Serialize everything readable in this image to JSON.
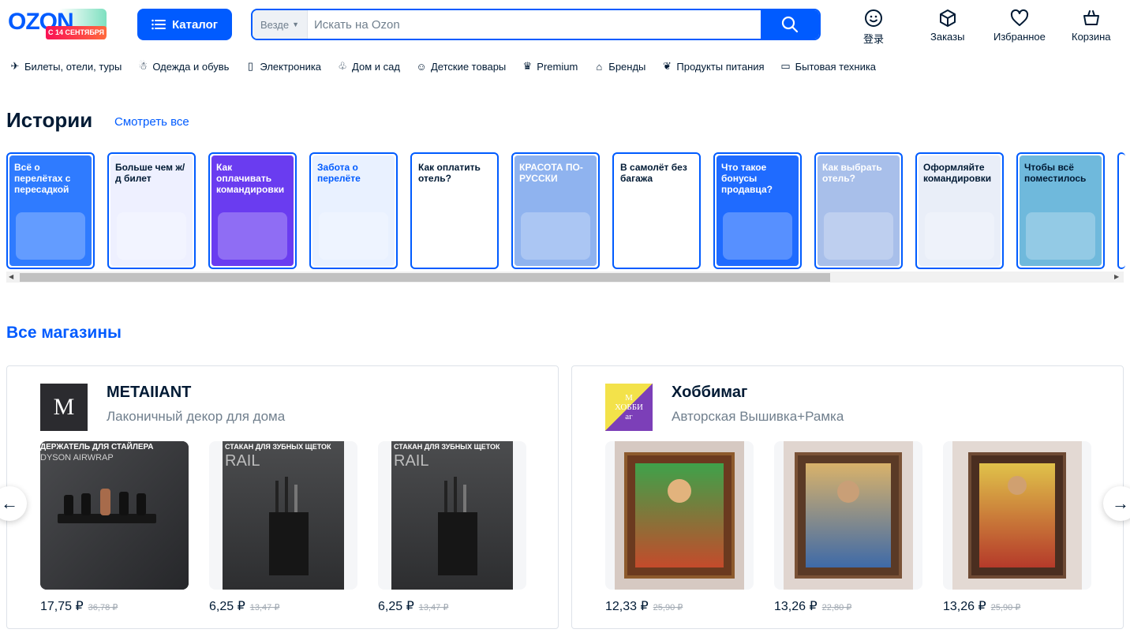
{
  "header": {
    "logo_text": "OZON",
    "logo_badge": "С 14 СЕНТЯБРЯ",
    "catalog_label": "Каталог",
    "search_scope": "Везде",
    "search_placeholder": "Искать на Ozon",
    "login_label": "登录",
    "orders_label": "Заказы",
    "favorites_label": "Избранное",
    "cart_label": "Корзина"
  },
  "nav": [
    {
      "label": "Билеты, отели, туры",
      "icon": "plane-icon"
    },
    {
      "label": "Одежда и обувь",
      "icon": "clothes-icon"
    },
    {
      "label": "Электроника",
      "icon": "phone-icon"
    },
    {
      "label": "Дом и сад",
      "icon": "plant-icon"
    },
    {
      "label": "Детские товары",
      "icon": "baby-icon"
    },
    {
      "label": "Premium",
      "icon": "crown-icon"
    },
    {
      "label": "Бренды",
      "icon": "store-icon"
    },
    {
      "label": "Продукты питания",
      "icon": "food-icon"
    },
    {
      "label": "Бытовая техника",
      "icon": "appliance-icon"
    }
  ],
  "stories": {
    "title": "Истории",
    "see_all": "Смотреть все",
    "items": [
      {
        "text": "Всё о перелётах с пересадкой",
        "bg": "#2f7bff",
        "color": "#ffffff"
      },
      {
        "text": "Больше чем ж/д билет",
        "bg": "#eef0ff",
        "color": "#001a34"
      },
      {
        "text": "Как оплачивать командировки",
        "bg": "#6a3cf0",
        "color": "#ffffff"
      },
      {
        "text": "Забота о перелёте",
        "bg": "#e9f1ff",
        "color": "#005bff"
      },
      {
        "text": "Как оплатить отель?",
        "bg": "#ffffff",
        "color": "#001a34"
      },
      {
        "text": "КРАСОТА ПО-РУССКИ",
        "bg": "#8fb3ef",
        "color": "#ffffff"
      },
      {
        "text": "В самолёт без багажа",
        "bg": "#ffffff",
        "color": "#001a34"
      },
      {
        "text": "Что такое бонусы продавца?",
        "bg": "#1f6bff",
        "color": "#ffffff"
      },
      {
        "text": "Как выбрать отель?",
        "bg": "#a8bfea",
        "color": "#ffffff"
      },
      {
        "text": "Оформляйте командировки",
        "bg": "#e9eef8",
        "color": "#001a34"
      },
      {
        "text": "Чтобы всё поместилось",
        "bg": "#6fb9dc",
        "color": "#001a34"
      }
    ]
  },
  "shops": {
    "title": "Все магазины",
    "cards": [
      {
        "name": "METAIIANT",
        "desc": "Лаконичный декор для дома",
        "logo_letter": "M",
        "products": [
          {
            "caption": "ДЕРЖАТЕЛЬ ДЛЯ СТАЙЛЕРА",
            "sub": "DYSON AIRWRAP",
            "price": "17,75 ₽",
            "old": "36,78 ₽"
          },
          {
            "caption": "СТАКАН ДЛЯ ЗУБНЫХ ЩЕТОК",
            "sub": "RAIL",
            "price": "6,25 ₽",
            "old": "13,47 ₽"
          },
          {
            "caption": "СТАКАН ДЛЯ ЗУБНЫХ ЩЕТОК",
            "sub": "RAIL",
            "price": "6,25 ₽",
            "old": "13,47 ₽"
          }
        ]
      },
      {
        "name": "Хоббимаг",
        "desc": "Авторская Вышивка+Рамка",
        "logo_letter": "М ХОББИ аг",
        "products": [
          {
            "caption": "",
            "sub": "",
            "price": "12,33 ₽",
            "old": "25,90 ₽"
          },
          {
            "caption": "",
            "sub": "",
            "price": "13,26 ₽",
            "old": "22,80 ₽"
          },
          {
            "caption": "",
            "sub": "",
            "price": "13,26 ₽",
            "old": "25,90 ₽"
          }
        ]
      }
    ]
  },
  "colors": {
    "accent": "#005bff",
    "text": "#001a34",
    "muted": "#707f8d"
  }
}
